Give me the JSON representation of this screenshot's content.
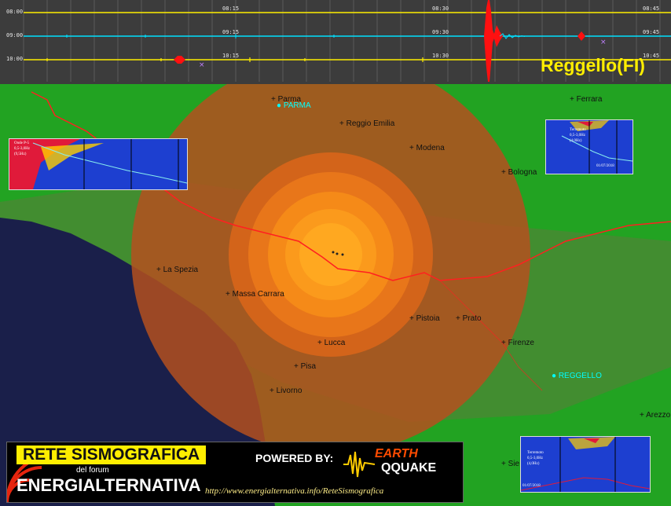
{
  "seismogram": {
    "station": "Reggello(FI)",
    "row_times": [
      "08:00",
      "09:00",
      "10:00"
    ],
    "row_ticks": [
      [
        "08:15",
        "08:30",
        "08:45"
      ],
      [
        "09:15",
        "09:30",
        "09:45"
      ],
      [
        "10:15",
        "10:30",
        "10:45"
      ]
    ],
    "colors": {
      "background": "#3c3c3c",
      "trace_yellow": "#ffee00",
      "trace_cyan": "#00e0ff",
      "event_red": "#ff1010"
    }
  },
  "map": {
    "cities": [
      {
        "name": "Parma",
        "cyan": false
      },
      {
        "name": "PARMA",
        "cyan": true
      },
      {
        "name": "Reggio Emilia",
        "cyan": false
      },
      {
        "name": "Modena",
        "cyan": false
      },
      {
        "name": "Ferrara",
        "cyan": false
      },
      {
        "name": "Bologna",
        "cyan": false
      },
      {
        "name": "La Spezia",
        "cyan": false
      },
      {
        "name": "Massa Carrara",
        "cyan": false
      },
      {
        "name": "Pistoia",
        "cyan": false
      },
      {
        "name": "Prato",
        "cyan": false
      },
      {
        "name": "Lucca",
        "cyan": false
      },
      {
        "name": "Firenze",
        "cyan": false
      },
      {
        "name": "Pisa",
        "cyan": false
      },
      {
        "name": "REGGELLO",
        "cyan": true
      },
      {
        "name": "Livorno",
        "cyan": false
      },
      {
        "name": "Arezzo",
        "cyan": false
      },
      {
        "name": "Sie",
        "cyan": false
      }
    ],
    "colors": {
      "land": "#2a9e2a",
      "sea": "#1a1f4a",
      "outer_ring": "#b4501f",
      "inner_ring": "#ff8c1a",
      "epicenter": "#ffb020",
      "border": "#ff2020"
    }
  },
  "insets": {
    "left": {
      "text": [
        "Onde P-5",
        "0,5-3,0Hz",
        "(9,5Hz)"
      ]
    },
    "top_right": {
      "text": [
        "Terremoto",
        "0,5-3,0Hz",
        "(4,0Hz)"
      ],
      "date": "01/07/2018"
    },
    "bottom_right": {
      "text": [
        "Terremoto",
        "0,5-3,0Hz",
        "(4,0Hz)"
      ],
      "date": "01/07/2018"
    }
  },
  "banner": {
    "title": "RETE SISMOGRAFICA",
    "subtitle": "del forum",
    "org": "ENERGIALTERNATIVA",
    "powered": "POWERED BY:",
    "logo_top": "EARTH",
    "logo_bottom": "QQUAKE",
    "url": "http://www.energialternativa.info/ReteSismografica"
  }
}
